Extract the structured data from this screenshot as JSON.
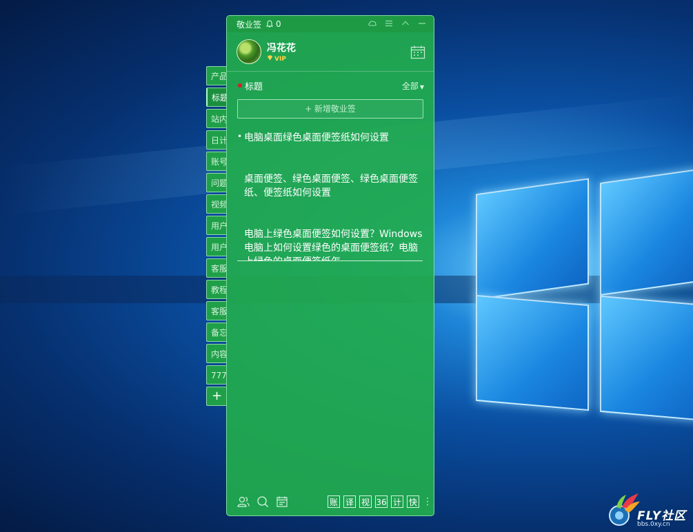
{
  "side_tabs": [
    "产品",
    "标题",
    "站内",
    "日计",
    "账号",
    "问题",
    "视频",
    "用户",
    "用户",
    "客服",
    "教程",
    "客服",
    "备忘",
    "内容",
    "777"
  ],
  "side_tabs_add": "+",
  "titlebar": {
    "app_name": "敬业签",
    "notification_count": "0"
  },
  "user": {
    "name": "冯花花",
    "badge": "VIP"
  },
  "category": {
    "title": "标题",
    "filter": "全部"
  },
  "add_note_label": "+ 新增敬业签",
  "notes": [
    "电脑桌面绿色桌面便签纸如何设置",
    "桌面便签、绿色桌面便签、绿色桌面便签纸、便签纸如何设置",
    "电脑上绿色桌面便签如何设置？Windows电脑上如何设置绿色的桌面便签纸？电脑上绿色的桌面便签纸怎"
  ],
  "bottom_buttons": [
    "账",
    "译",
    "视",
    "36",
    "计",
    "快"
  ],
  "watermark": {
    "brand": "FLY社区",
    "url": "bbs.0xy.cn"
  },
  "colors": {
    "note_green": "#22ac4e",
    "titlebar_green": "#1e9a45",
    "vip_gold": "#ffd54a",
    "active_dot": "#e0182a"
  }
}
